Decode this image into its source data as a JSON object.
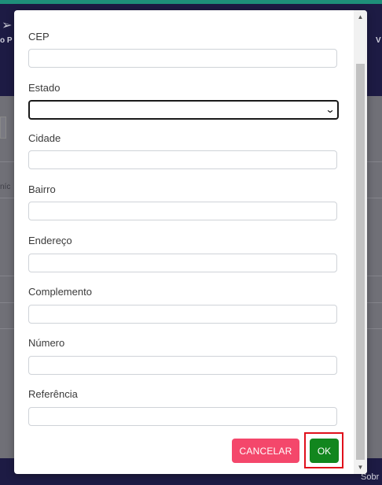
{
  "background": {
    "nav_left_text": "o P",
    "nav_right_text": "V",
    "column_label": "níc",
    "footer_text": "Sobr"
  },
  "form": {
    "fields": [
      {
        "label": "CEP",
        "value": "",
        "type": "text"
      },
      {
        "label": "Estado",
        "value": "",
        "type": "select"
      },
      {
        "label": "Cidade",
        "value": "",
        "type": "text"
      },
      {
        "label": "Bairro",
        "value": "",
        "type": "text"
      },
      {
        "label": "Endereço",
        "value": "",
        "type": "text"
      },
      {
        "label": "Complemento",
        "value": "",
        "type": "text"
      },
      {
        "label": "Número",
        "value": "",
        "type": "text"
      },
      {
        "label": "Referência",
        "value": "",
        "type": "text"
      }
    ]
  },
  "actions": {
    "cancel_label": "CANCELAR",
    "ok_label": "OK"
  },
  "colors": {
    "cancel": "#f4476b",
    "ok": "#12861e",
    "highlight": "#e0101b",
    "nav": "#1d1b44",
    "accent": "#1e8f79"
  },
  "icons": {
    "nav_icon": "send-icon",
    "select_icon": "chevron-down-icon"
  }
}
